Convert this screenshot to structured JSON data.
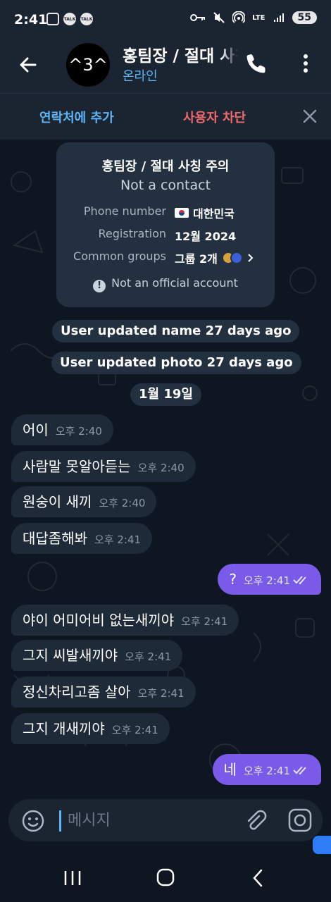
{
  "status_bar": {
    "time": "2:41",
    "left_icons": [
      "screenshot-icon",
      "kakaotalk-icon",
      "kakaotalk-icon"
    ],
    "right_icons": [
      "key-icon",
      "mute-icon",
      "hotspot-icon",
      "lte-signal-icon",
      "signal-icon"
    ],
    "lte_label": "LTE",
    "battery": "55"
  },
  "header": {
    "avatar_text": "^3^",
    "title": "홍팀장 / 절대 사칭 주의",
    "status": "온라인"
  },
  "action_bar": {
    "add_contact": "연락처에 추가",
    "block_user": "사용자 차단"
  },
  "info_card": {
    "name": "홍팀장 / 절대 사칭 주의",
    "subtitle": "Not a contact",
    "rows": [
      {
        "key": "Phone number",
        "value": "대한민국"
      },
      {
        "key": "Registration",
        "value": "12월 2024"
      },
      {
        "key": "Common groups",
        "value": "그룹 2개"
      }
    ],
    "official_note": "Not an official account"
  },
  "service_messages": [
    "User updated name 27 days ago",
    "User updated photo 27 days ago",
    "1월 19일"
  ],
  "messages": [
    {
      "dir": "in",
      "text": "어이",
      "time": "오후 2:40"
    },
    {
      "dir": "in",
      "text": "사람말 못알아듣는",
      "time": "오후 2:40"
    },
    {
      "dir": "in",
      "text": "원숭이 새끼",
      "time": "오후 2:40"
    },
    {
      "dir": "in",
      "text": "대답좀해봐",
      "time": "오후 2:41"
    },
    {
      "dir": "out",
      "text": "?",
      "time": "오후 2:41"
    },
    {
      "dir": "in",
      "text": "야이 어미어비 없는새끼야",
      "time": "오후 2:41"
    },
    {
      "dir": "in",
      "text": "그지 씨발새끼야",
      "time": "오후 2:41"
    },
    {
      "dir": "in",
      "text": "정신차리고좀 살아",
      "time": "오후 2:41"
    },
    {
      "dir": "in",
      "text": "그지 개새끼야",
      "time": "오후 2:41"
    },
    {
      "dir": "out",
      "text": "네",
      "time": "오후 2:41"
    }
  ],
  "input": {
    "placeholder": "메시지"
  },
  "colors": {
    "background": "#0e1621",
    "header": "#1b2532",
    "accent_blue": "#5eb5f7",
    "block_red": "#f06a6a",
    "outgoing_bubble": "#7a5ae8",
    "incoming_bubble": "#1f2a38"
  }
}
